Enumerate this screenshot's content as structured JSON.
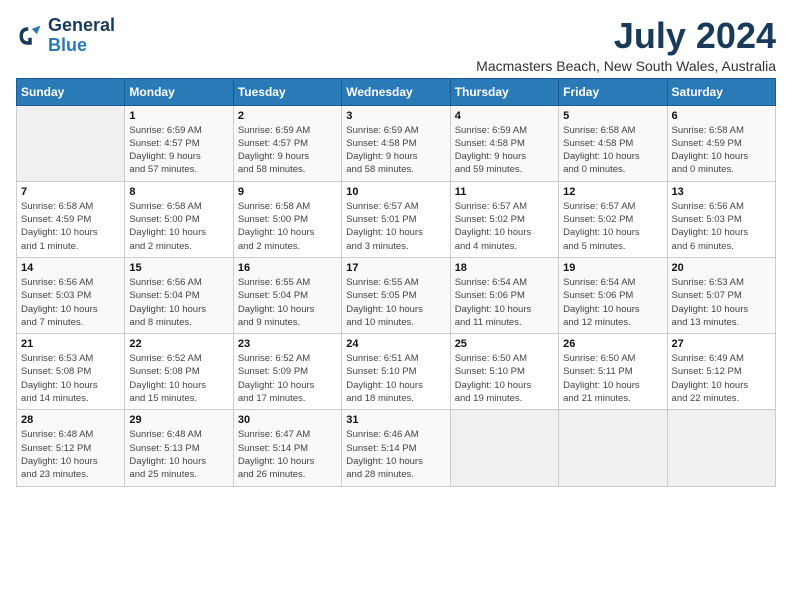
{
  "header": {
    "logo_line1": "General",
    "logo_line2": "Blue",
    "title": "July 2024",
    "subtitle": "Macmasters Beach, New South Wales, Australia"
  },
  "calendar": {
    "days_of_week": [
      "Sunday",
      "Monday",
      "Tuesday",
      "Wednesday",
      "Thursday",
      "Friday",
      "Saturday"
    ],
    "weeks": [
      [
        {
          "day": "",
          "info": ""
        },
        {
          "day": "1",
          "info": "Sunrise: 6:59 AM\nSunset: 4:57 PM\nDaylight: 9 hours\nand 57 minutes."
        },
        {
          "day": "2",
          "info": "Sunrise: 6:59 AM\nSunset: 4:57 PM\nDaylight: 9 hours\nand 58 minutes."
        },
        {
          "day": "3",
          "info": "Sunrise: 6:59 AM\nSunset: 4:58 PM\nDaylight: 9 hours\nand 58 minutes."
        },
        {
          "day": "4",
          "info": "Sunrise: 6:59 AM\nSunset: 4:58 PM\nDaylight: 9 hours\nand 59 minutes."
        },
        {
          "day": "5",
          "info": "Sunrise: 6:58 AM\nSunset: 4:58 PM\nDaylight: 10 hours\nand 0 minutes."
        },
        {
          "day": "6",
          "info": "Sunrise: 6:58 AM\nSunset: 4:59 PM\nDaylight: 10 hours\nand 0 minutes."
        }
      ],
      [
        {
          "day": "7",
          "info": "Sunrise: 6:58 AM\nSunset: 4:59 PM\nDaylight: 10 hours\nand 1 minute."
        },
        {
          "day": "8",
          "info": "Sunrise: 6:58 AM\nSunset: 5:00 PM\nDaylight: 10 hours\nand 2 minutes."
        },
        {
          "day": "9",
          "info": "Sunrise: 6:58 AM\nSunset: 5:00 PM\nDaylight: 10 hours\nand 2 minutes."
        },
        {
          "day": "10",
          "info": "Sunrise: 6:57 AM\nSunset: 5:01 PM\nDaylight: 10 hours\nand 3 minutes."
        },
        {
          "day": "11",
          "info": "Sunrise: 6:57 AM\nSunset: 5:02 PM\nDaylight: 10 hours\nand 4 minutes."
        },
        {
          "day": "12",
          "info": "Sunrise: 6:57 AM\nSunset: 5:02 PM\nDaylight: 10 hours\nand 5 minutes."
        },
        {
          "day": "13",
          "info": "Sunrise: 6:56 AM\nSunset: 5:03 PM\nDaylight: 10 hours\nand 6 minutes."
        }
      ],
      [
        {
          "day": "14",
          "info": "Sunrise: 6:56 AM\nSunset: 5:03 PM\nDaylight: 10 hours\nand 7 minutes."
        },
        {
          "day": "15",
          "info": "Sunrise: 6:56 AM\nSunset: 5:04 PM\nDaylight: 10 hours\nand 8 minutes."
        },
        {
          "day": "16",
          "info": "Sunrise: 6:55 AM\nSunset: 5:04 PM\nDaylight: 10 hours\nand 9 minutes."
        },
        {
          "day": "17",
          "info": "Sunrise: 6:55 AM\nSunset: 5:05 PM\nDaylight: 10 hours\nand 10 minutes."
        },
        {
          "day": "18",
          "info": "Sunrise: 6:54 AM\nSunset: 5:06 PM\nDaylight: 10 hours\nand 11 minutes."
        },
        {
          "day": "19",
          "info": "Sunrise: 6:54 AM\nSunset: 5:06 PM\nDaylight: 10 hours\nand 12 minutes."
        },
        {
          "day": "20",
          "info": "Sunrise: 6:53 AM\nSunset: 5:07 PM\nDaylight: 10 hours\nand 13 minutes."
        }
      ],
      [
        {
          "day": "21",
          "info": "Sunrise: 6:53 AM\nSunset: 5:08 PM\nDaylight: 10 hours\nand 14 minutes."
        },
        {
          "day": "22",
          "info": "Sunrise: 6:52 AM\nSunset: 5:08 PM\nDaylight: 10 hours\nand 15 minutes."
        },
        {
          "day": "23",
          "info": "Sunrise: 6:52 AM\nSunset: 5:09 PM\nDaylight: 10 hours\nand 17 minutes."
        },
        {
          "day": "24",
          "info": "Sunrise: 6:51 AM\nSunset: 5:10 PM\nDaylight: 10 hours\nand 18 minutes."
        },
        {
          "day": "25",
          "info": "Sunrise: 6:50 AM\nSunset: 5:10 PM\nDaylight: 10 hours\nand 19 minutes."
        },
        {
          "day": "26",
          "info": "Sunrise: 6:50 AM\nSunset: 5:11 PM\nDaylight: 10 hours\nand 21 minutes."
        },
        {
          "day": "27",
          "info": "Sunrise: 6:49 AM\nSunset: 5:12 PM\nDaylight: 10 hours\nand 22 minutes."
        }
      ],
      [
        {
          "day": "28",
          "info": "Sunrise: 6:48 AM\nSunset: 5:12 PM\nDaylight: 10 hours\nand 23 minutes."
        },
        {
          "day": "29",
          "info": "Sunrise: 6:48 AM\nSunset: 5:13 PM\nDaylight: 10 hours\nand 25 minutes."
        },
        {
          "day": "30",
          "info": "Sunrise: 6:47 AM\nSunset: 5:14 PM\nDaylight: 10 hours\nand 26 minutes."
        },
        {
          "day": "31",
          "info": "Sunrise: 6:46 AM\nSunset: 5:14 PM\nDaylight: 10 hours\nand 28 minutes."
        },
        {
          "day": "",
          "info": ""
        },
        {
          "day": "",
          "info": ""
        },
        {
          "day": "",
          "info": ""
        }
      ]
    ]
  }
}
